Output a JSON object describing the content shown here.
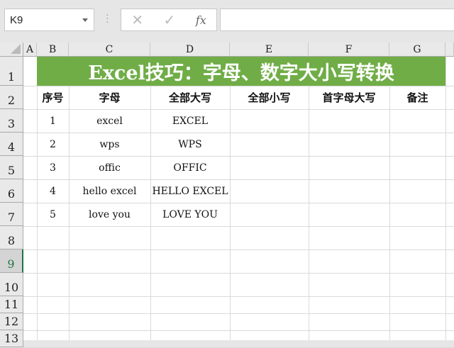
{
  "name_box": "K9",
  "formula_bar": {
    "cancel": "✕",
    "confirm": "✓",
    "fx": "fx",
    "value": ""
  },
  "columns": [
    "A",
    "B",
    "C",
    "D",
    "E",
    "F",
    "G"
  ],
  "rows": [
    "1",
    "2",
    "3",
    "4",
    "5",
    "6",
    "7",
    "8",
    "9",
    "10",
    "11",
    "12",
    "13"
  ],
  "selected_row": "9",
  "title": "Excel技巧：字母、数字大小写转换",
  "headers": [
    "序号",
    "字母",
    "全部大写",
    "全部小写",
    "首字母大写",
    "备注"
  ],
  "data": [
    [
      "1",
      "excel",
      "EXCEL"
    ],
    [
      "2",
      "wps",
      "WPS"
    ],
    [
      "3",
      "offic",
      "OFFIC"
    ],
    [
      "4",
      "hello excel",
      "HELLO EXCEL"
    ],
    [
      "5",
      "love you",
      "LOVE YOU"
    ]
  ],
  "colors": {
    "title_bg": "#70ad47",
    "selection": "#217346"
  }
}
